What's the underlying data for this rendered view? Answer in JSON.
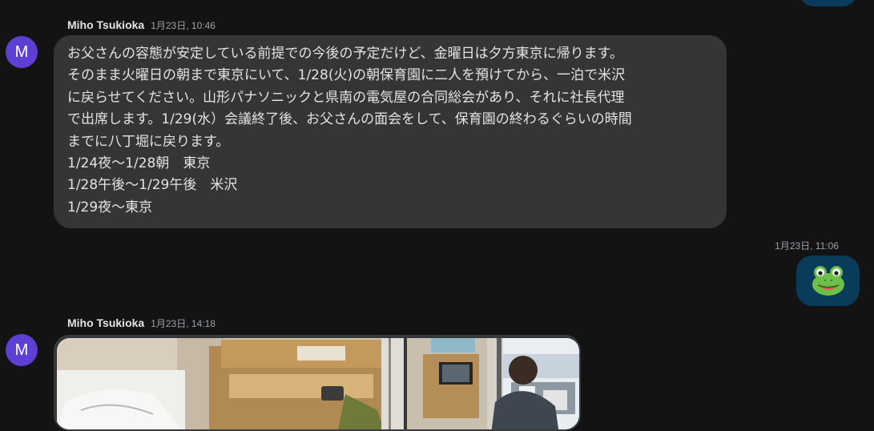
{
  "messages": [
    {
      "avatar_letter": "M",
      "sender": "Miho Tsukioka",
      "time": "1月23日, 10:46",
      "lines": [
        "お父さんの容態が安定している前提での今後の予定だけど、金曜日は夕方東京に帰ります。",
        "そのまま火曜日の朝まで東京にいて、1/28(火)の朝保育園に二人を預けてから、一泊で米沢",
        "に戻らせてください。山形パナソニックと県南の電気屋の合同総会があり、それに社長代理",
        "で出席します。1/29(水）会議終了後、お父さんの面会をして、保育園の終わるぐらいの時間",
        "までに八丁堀に戻ります。",
        "1/24夜〜1/28朝　東京",
        "1/28午後〜1/29午後　米沢",
        "1/29夜〜東京"
      ]
    },
    {
      "outgoing": true,
      "time": "1月23日, 11:06",
      "emoji_icon": "frog-face-icon"
    },
    {
      "avatar_letter": "M",
      "sender": "Miho Tsukioka",
      "time": "1月23日, 14:18",
      "attachments": [
        "photo",
        "photo"
      ]
    }
  ],
  "colors": {
    "background": "#131314",
    "incoming_bubble": "#333537",
    "outgoing_bubble": "#0b3b5b",
    "avatar": "#5d3fd3",
    "text": "#e3e3e3",
    "muted": "#9aa0a6"
  }
}
